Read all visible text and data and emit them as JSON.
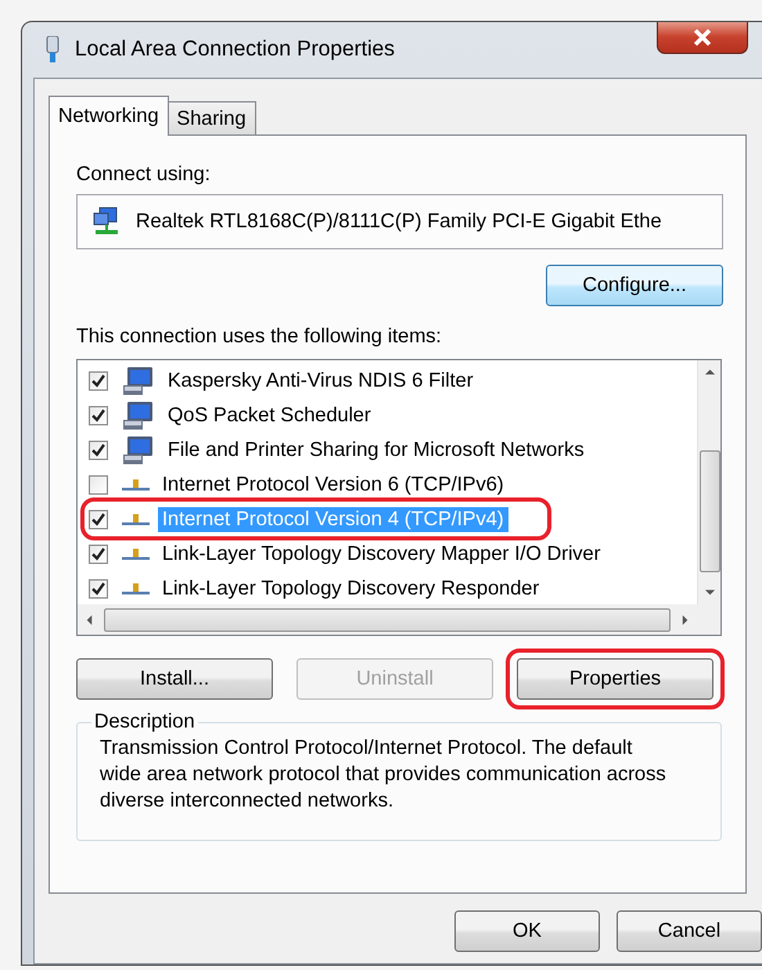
{
  "window": {
    "title": "Local Area Connection Properties"
  },
  "tabs": [
    {
      "label": "Networking",
      "selected": true
    },
    {
      "label": "Sharing",
      "selected": false
    }
  ],
  "connect_using": {
    "label": "Connect using:",
    "adapter": "Realtek RTL8168C(P)/8111C(P) Family PCI-E Gigabit Ethe",
    "configure_button": "Configure..."
  },
  "items_label": "This connection uses the following items:",
  "items": [
    {
      "label": "Kaspersky Anti-Virus NDIS 6 Filter",
      "kind": "service",
      "checked": true,
      "selected": false,
      "highlighted": false
    },
    {
      "label": "QoS Packet Scheduler",
      "kind": "service",
      "checked": true,
      "selected": false,
      "highlighted": false
    },
    {
      "label": "File and Printer Sharing for Microsoft Networks",
      "kind": "service",
      "checked": true,
      "selected": false,
      "highlighted": false
    },
    {
      "label": "Internet Protocol Version 6 (TCP/IPv6)",
      "kind": "protocol",
      "checked": false,
      "selected": false,
      "highlighted": false
    },
    {
      "label": "Internet Protocol Version 4 (TCP/IPv4)",
      "kind": "protocol",
      "checked": true,
      "selected": true,
      "highlighted": true
    },
    {
      "label": "Link-Layer Topology Discovery Mapper I/O Driver",
      "kind": "protocol",
      "checked": true,
      "selected": false,
      "highlighted": false
    },
    {
      "label": "Link-Layer Topology Discovery Responder",
      "kind": "protocol",
      "checked": true,
      "selected": false,
      "highlighted": false
    }
  ],
  "item_buttons": [
    {
      "label": "Install...",
      "disabled": false,
      "highlighted": false
    },
    {
      "label": "Uninstall",
      "disabled": true,
      "highlighted": false
    },
    {
      "label": "Properties",
      "disabled": false,
      "highlighted": true
    }
  ],
  "description": {
    "title": "Description",
    "text": "Transmission Control Protocol/Internet Protocol. The default wide area network protocol that provides communication across diverse interconnected networks."
  },
  "dialog_buttons": [
    "OK",
    "Cancel"
  ]
}
